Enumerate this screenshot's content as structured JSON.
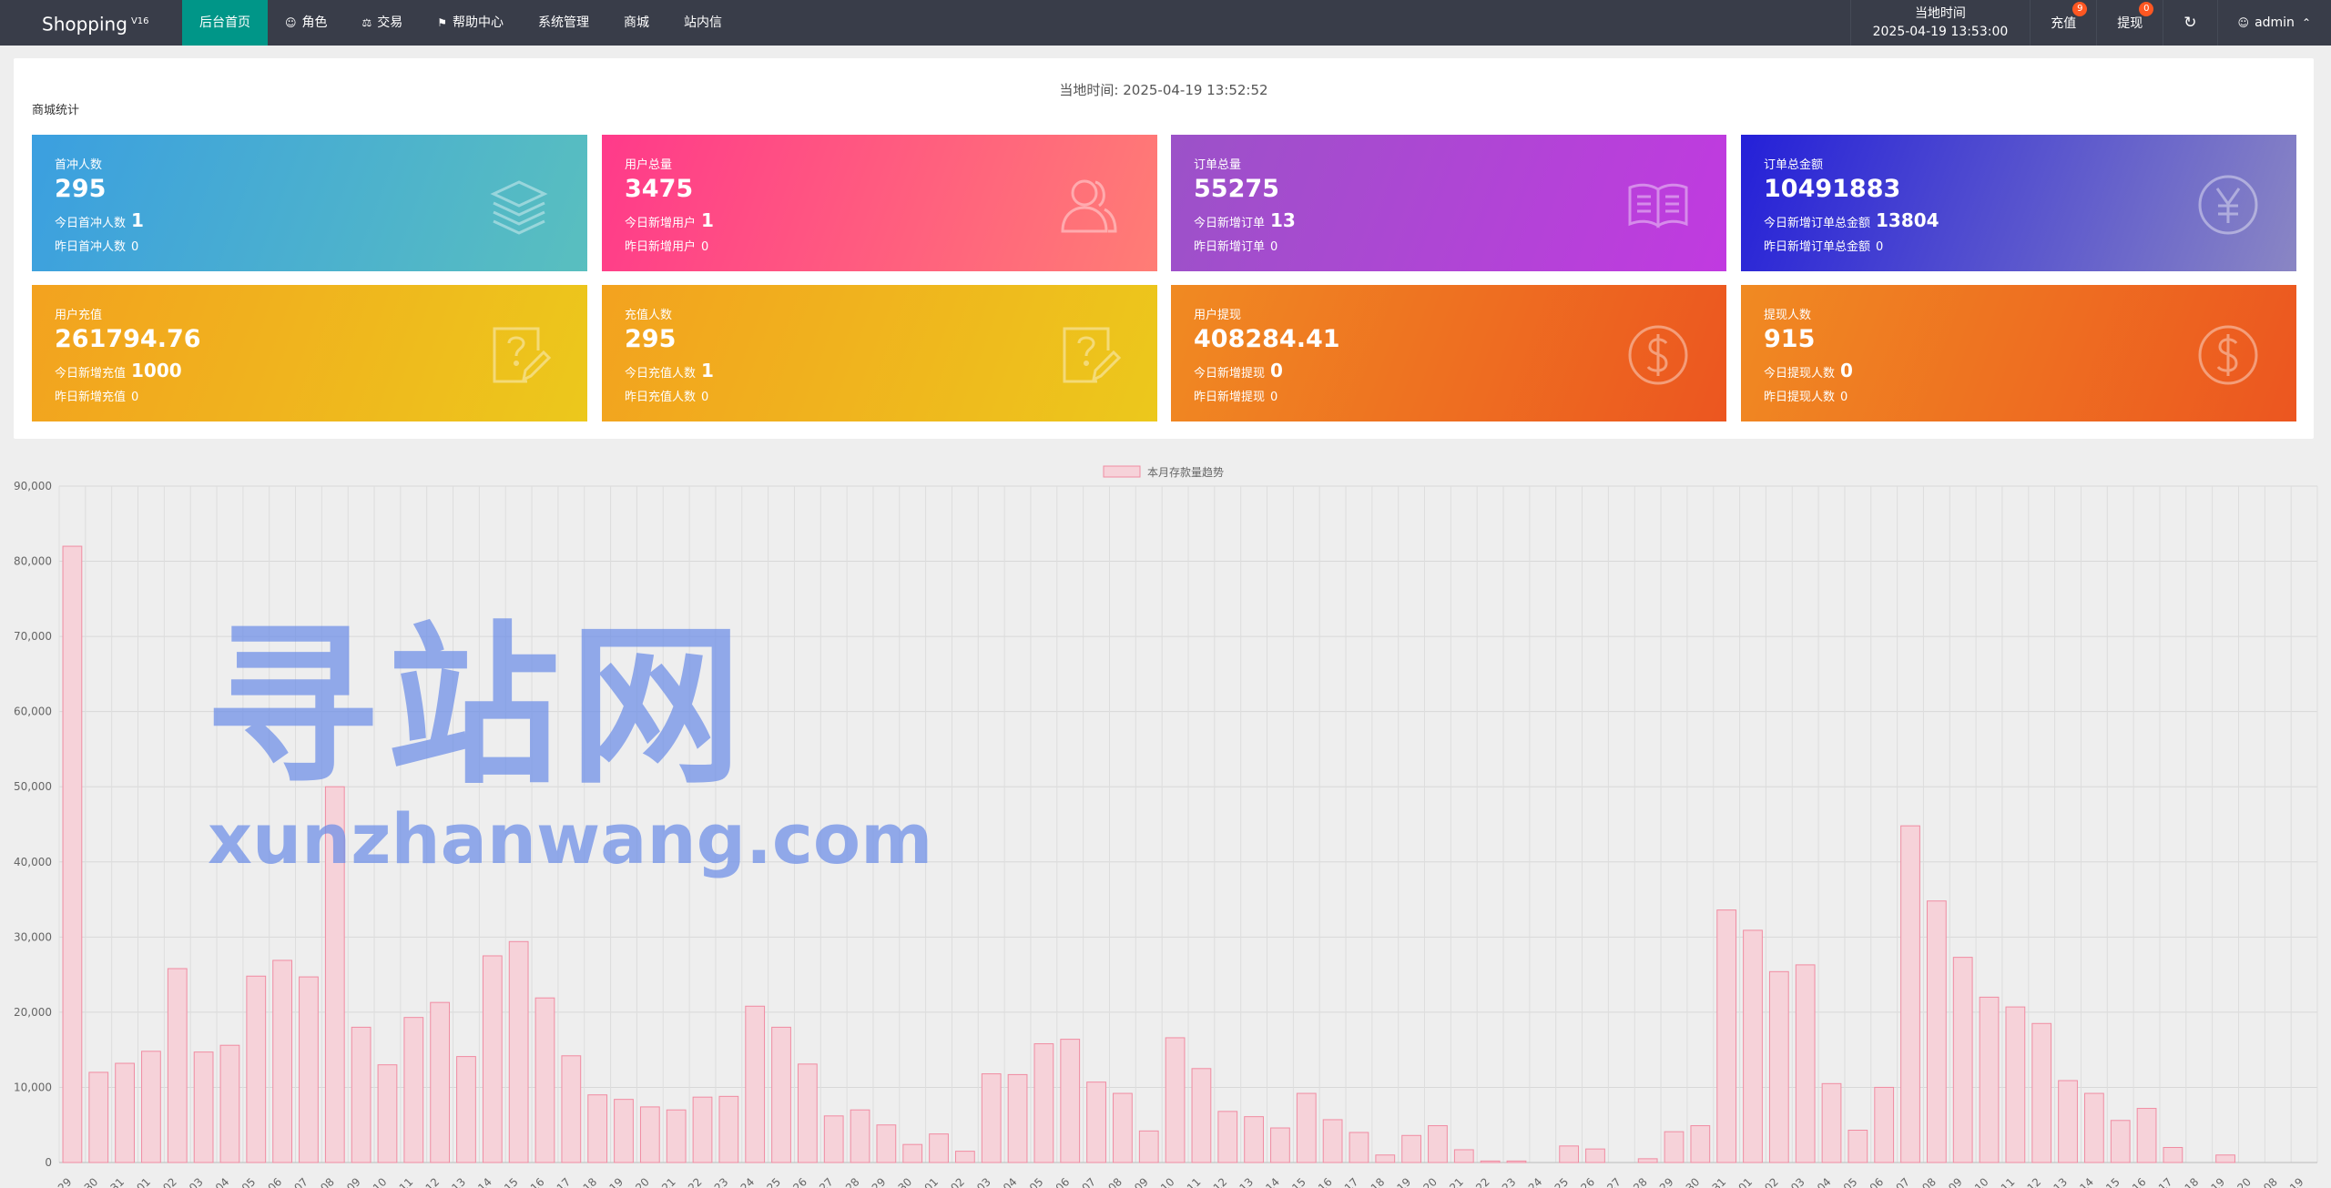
{
  "header": {
    "brand": "Shopping",
    "brand_version": "V16",
    "nav": [
      {
        "label": "后台首页",
        "icon": "",
        "active": true
      },
      {
        "label": "角色",
        "icon": "user-icon"
      },
      {
        "label": "交易",
        "icon": "scale-icon"
      },
      {
        "label": "帮助中心",
        "icon": "flag-icon"
      },
      {
        "label": "系统管理",
        "icon": ""
      },
      {
        "label": "商城",
        "icon": ""
      },
      {
        "label": "站内信",
        "icon": ""
      }
    ],
    "local_time_label": "当地时间",
    "local_time_value": "2025-04-19 13:53:00",
    "recharge_label": "充值",
    "recharge_badge": "9",
    "withdraw_label": "提现",
    "withdraw_badge": "0",
    "refresh_icon": "refresh-icon",
    "admin_label": "admin",
    "colors": {
      "bar": "#393d49",
      "active": "#009688",
      "badge": "#ff5722"
    }
  },
  "panel": {
    "local_time_text": "当地时间:  2025-04-19 13:52:52",
    "title": "商城统计"
  },
  "cards": [
    {
      "title": "首冲人数",
      "total": "295",
      "today_label": "今日首冲人数",
      "today_value": "1",
      "yesterday_label": "昨日首冲人数",
      "yesterday_value": "0",
      "icon": "layers-icon",
      "colors": [
        "#3b9fe0",
        "#59bfbf"
      ]
    },
    {
      "title": "用户总量",
      "total": "3475",
      "today_label": "今日新增用户",
      "today_value": "1",
      "yesterday_label": "昨日新增用户",
      "yesterday_value": "0",
      "icon": "users-icon",
      "colors": [
        "#ff3a8a",
        "#ff7d75"
      ]
    },
    {
      "title": "订单总量",
      "total": "55275",
      "today_label": "今日新增订单",
      "today_value": "13",
      "yesterday_label": "昨日新增订单",
      "yesterday_value": "0",
      "icon": "book-icon",
      "colors": [
        "#9b52c8",
        "#c13ae0"
      ]
    },
    {
      "title": "订单总金额",
      "total": "10491883",
      "today_label": "今日新增订单总金额",
      "today_value": "13804",
      "yesterday_label": "昨日新增订单总金额",
      "yesterday_value": "0",
      "icon": "yen-icon",
      "colors": [
        "#2420d8",
        "#8a86c4"
      ]
    },
    {
      "title": "用户充值",
      "total": "261794.76",
      "today_label": "今日新增充值",
      "today_value": "1000",
      "yesterday_label": "昨日新增充值",
      "yesterday_value": "0",
      "icon": "edit-question-icon",
      "colors": [
        "#f3a21f",
        "#ecc81c"
      ]
    },
    {
      "title": "充值人数",
      "total": "295",
      "today_label": "今日充值人数",
      "today_value": "1",
      "yesterday_label": "昨日充值人数",
      "yesterday_value": "0",
      "icon": "edit-question-icon",
      "colors": [
        "#f3a21f",
        "#ecc81c"
      ]
    },
    {
      "title": "用户提现",
      "total": "408284.41",
      "today_label": "今日新增提现",
      "today_value": "0",
      "yesterday_label": "昨日新增提现",
      "yesterday_value": "0",
      "icon": "dollar-icon",
      "colors": [
        "#f08a22",
        "#ec5620"
      ]
    },
    {
      "title": "提现人数",
      "total": "915",
      "today_label": "今日提现人数",
      "today_value": "0",
      "yesterday_label": "昨日提现人数",
      "yesterday_value": "0",
      "icon": "dollar-icon",
      "colors": [
        "#f08a22",
        "#ec5620"
      ]
    }
  ],
  "watermark": {
    "cn": "寻站网",
    "url": "xunzhanwang.com"
  },
  "chart_data": {
    "type": "bar",
    "title": "",
    "xlabel": "",
    "ylabel": "",
    "ylim": [
      0,
      90000
    ],
    "yticks": [
      0,
      10000,
      20000,
      30000,
      40000,
      50000,
      60000,
      70000,
      80000,
      90000
    ],
    "grid": true,
    "legend_position": "top-center",
    "bar_fill": "#f6d2d9",
    "bar_stroke": "#f08ca2",
    "categories": [
      "29",
      "30",
      "31",
      "01",
      "02",
      "03",
      "04",
      "05",
      "06",
      "07",
      "08",
      "09",
      "10",
      "11",
      "12",
      "13",
      "14",
      "15",
      "16",
      "17",
      "18",
      "19",
      "20",
      "21",
      "22",
      "23",
      "24",
      "25",
      "26",
      "27",
      "28",
      "29",
      "30",
      "01",
      "02",
      "03",
      "04",
      "05",
      "06",
      "07",
      "08",
      "09",
      "10",
      "11",
      "12",
      "13",
      "14",
      "15",
      "16",
      "17",
      "18",
      "19",
      "20",
      "21",
      "22",
      "23",
      "24",
      "25",
      "26",
      "27",
      "28",
      "29",
      "30",
      "31",
      "01",
      "02",
      "03",
      "04",
      "05",
      "06",
      "07",
      "08",
      "09",
      "10",
      "11",
      "12",
      "13",
      "14",
      "15",
      "16",
      "17",
      "18",
      "19",
      "20",
      "08",
      "19"
    ],
    "series": [
      {
        "name": "本月存款量趋势",
        "values": [
          82000,
          12000,
          13200,
          14800,
          25800,
          14700,
          15600,
          24800,
          26900,
          24700,
          50000,
          18000,
          13000,
          19300,
          21300,
          14100,
          27500,
          29400,
          21900,
          14200,
          9000,
          8400,
          7400,
          7000,
          8700,
          8800,
          20800,
          18000,
          13100,
          6200,
          7000,
          5000,
          2400,
          3800,
          1500,
          11800,
          11700,
          15800,
          16400,
          10700,
          9200,
          4200,
          16600,
          12500,
          6800,
          6100,
          4600,
          9200,
          5700,
          4000,
          1000,
          3600,
          4900,
          1700,
          200,
          200,
          0,
          2200,
          1800,
          0,
          500,
          4100,
          4900,
          33600,
          30900,
          25400,
          26300,
          10500,
          4300,
          10000,
          44800,
          34800,
          27300,
          22000,
          20700,
          18500,
          10900,
          9200,
          5600,
          7200,
          2000,
          0,
          1000
        ]
      }
    ]
  }
}
